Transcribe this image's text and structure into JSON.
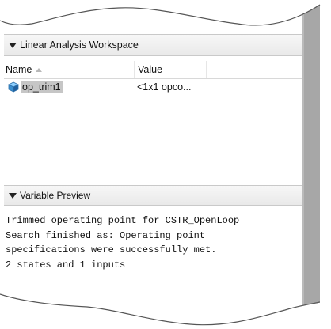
{
  "workspace": {
    "title": "Linear Analysis Workspace",
    "columns": {
      "name": "Name",
      "value": "Value"
    },
    "rows": [
      {
        "name": "op_trim1",
        "value": "<1x1 opco..."
      }
    ]
  },
  "preview": {
    "title": "Variable Preview",
    "lines": [
      "Trimmed operating point for CSTR_OpenLoop",
      "Search finished as: Operating point",
      "specifications were successfully met.",
      "2 states and 1 inputs"
    ]
  },
  "colors": {
    "header_bg": "#ececec",
    "selection": "#c6c6c6",
    "shadow": "#a7a7a7",
    "icon": "#4aa3df"
  },
  "icons": [
    "expand-triangle-icon",
    "sort-ascending-icon",
    "variable-cube-icon"
  ]
}
